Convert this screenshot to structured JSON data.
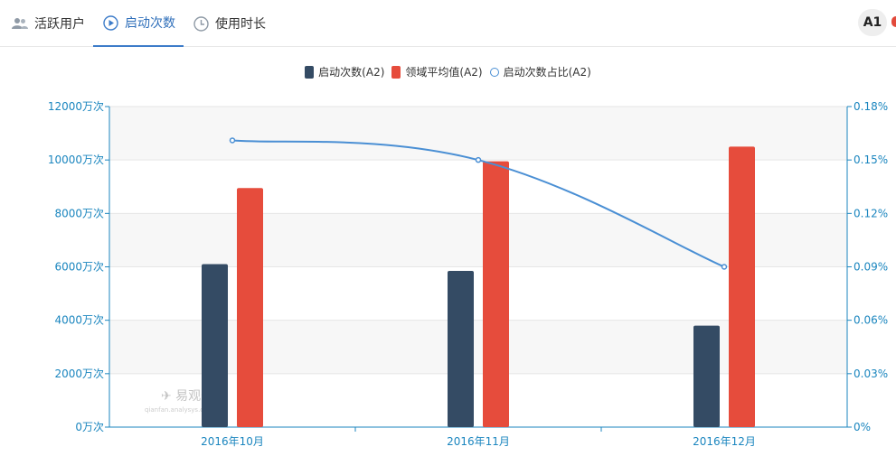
{
  "tabs": [
    {
      "label": "活跃用户",
      "icon": "users-icon",
      "active": false
    },
    {
      "label": "启动次数",
      "icon": "play-circle-icon",
      "active": true
    },
    {
      "label": "使用时长",
      "icon": "clock-icon",
      "active": false
    }
  ],
  "avatar": {
    "label": "A1"
  },
  "watermark": {
    "brand": "易观千帆",
    "url": "qianfan.analysys.cn"
  },
  "colors": {
    "bar1": "#344b64",
    "bar2": "#e64c3c",
    "line": "#4a8fd4",
    "axis": "#1b86bf",
    "active_tab": "#3d7cc9"
  },
  "chart_data": {
    "type": "bar",
    "categories": [
      "2016年10月",
      "2016年11月",
      "2016年12月"
    ],
    "series": [
      {
        "name": "启动次数(A2)",
        "type": "bar",
        "axis": "left",
        "values": [
          6100,
          5850,
          3800
        ]
      },
      {
        "name": "领域平均值(A2)",
        "type": "bar",
        "axis": "left",
        "values": [
          8950,
          9950,
          10500
        ]
      },
      {
        "name": "启动次数占比(A2)",
        "type": "line",
        "axis": "right",
        "values": [
          0.161,
          0.15,
          0.09
        ]
      }
    ],
    "y_left": {
      "ticks": [
        "0万次",
        "2000万次",
        "4000万次",
        "6000万次",
        "8000万次",
        "10000万次",
        "12000万次"
      ],
      "min": 0,
      "max": 12000
    },
    "y_right": {
      "ticks": [
        "0%",
        "0.03%",
        "0.06%",
        "0.09%",
        "0.12%",
        "0.15%",
        "0.18%"
      ],
      "min": 0,
      "max": 0.18
    },
    "legend_position": "top-center",
    "grid": true
  }
}
